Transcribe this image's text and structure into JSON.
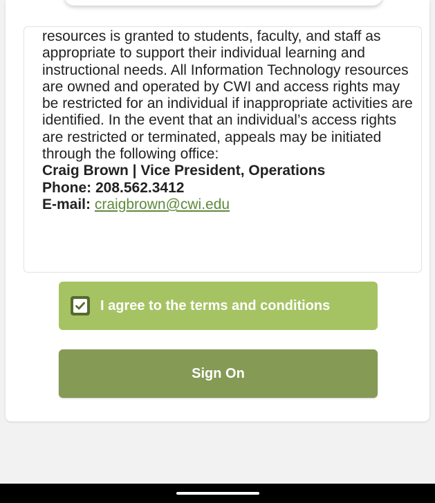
{
  "terms": {
    "body": "resources is granted to students, faculty, and staff as appropriate to support their individual learning and instructional needs. All Information Technology resources are owned and operated by CWI and access rights may be restricted for an individual if inappropriate activities are identified. In the event that an individual’s access rights are restricted or terminated, appeals may be initiated through the following office:",
    "contact_name": "Craig Brown | Vice President, Operations",
    "phone": "Phone: 208.562.3412",
    "email_label": "E-mail:",
    "email": "craigbrown@cwi.edu"
  },
  "agree": {
    "label": "I agree to the terms and conditions",
    "checked": true
  },
  "signon": {
    "label": "Sign On"
  },
  "colors": {
    "agree_bg": "#a6c363",
    "signon_bg": "#859a54",
    "checkbox": "#556b2f",
    "link": "#5d8a3a"
  }
}
